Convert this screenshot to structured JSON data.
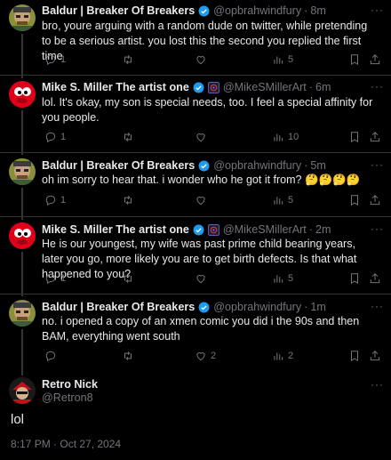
{
  "tweets": [
    {
      "name": "Baldur | Breaker Of Breakers",
      "handle": "@opbrahwindfury",
      "time": "8m",
      "text": "bro, youre arguing with a random dude on twitter, while pretending to be a serious artist. you lost this the second you replied the first time",
      "replies": "1",
      "retweets": "",
      "likes": "",
      "views": "5",
      "avatar": "cartoon-avatar"
    },
    {
      "name": "Mike S. Miller The artist one",
      "handle": "@MikeSMillerArt",
      "time": "6m",
      "text": "lol. It's okay, my son is special needs, too. I feel a special affinity for you people.",
      "replies": "1",
      "retweets": "",
      "likes": "",
      "views": "10",
      "avatar": "red-avatar"
    },
    {
      "name": "Baldur | Breaker Of Breakers",
      "handle": "@opbrahwindfury",
      "time": "5m",
      "text": "oh im sorry to hear that. i wonder who he got it from? 🤔🤔🤔🤔",
      "replies": "1",
      "retweets": "",
      "likes": "",
      "views": "5",
      "avatar": "cartoon-avatar"
    },
    {
      "name": "Mike S. Miller The artist one",
      "handle": "@MikeSMillerArt",
      "time": "2m",
      "text": "He is our youngest, my wife was past prime child bearing years, later you go, more likely you are to get birth defects. Is that what happened to you?",
      "replies": "1",
      "retweets": "",
      "likes": "",
      "views": "5",
      "avatar": "red-avatar"
    },
    {
      "name": "Baldur | Breaker Of Breakers",
      "handle": "@opbrahwindfury",
      "time": "1m",
      "text": "no. i opened a copy of an xmen comic you did i the 90s and then BAM, everything went south",
      "replies": "",
      "retweets": "",
      "likes": "2",
      "views": "2",
      "avatar": "cartoon-avatar"
    }
  ],
  "main": {
    "name": "Retro Nick",
    "handle": "@Retron8",
    "text": "lol",
    "timestamp": "8:17 PM · Oct 27, 2024"
  },
  "dot": "·",
  "more": "···",
  "colors": {
    "background": "#000000",
    "text": "#e7e9ea",
    "muted": "#71767b",
    "verified": "#1d9bf0",
    "divider": "#2f3336"
  },
  "icons": [
    "reply-icon",
    "retweet-icon",
    "like-icon",
    "views-icon",
    "bookmark-icon",
    "share-icon",
    "verified-icon",
    "affiliate-badge-icon",
    "more-icon"
  ]
}
